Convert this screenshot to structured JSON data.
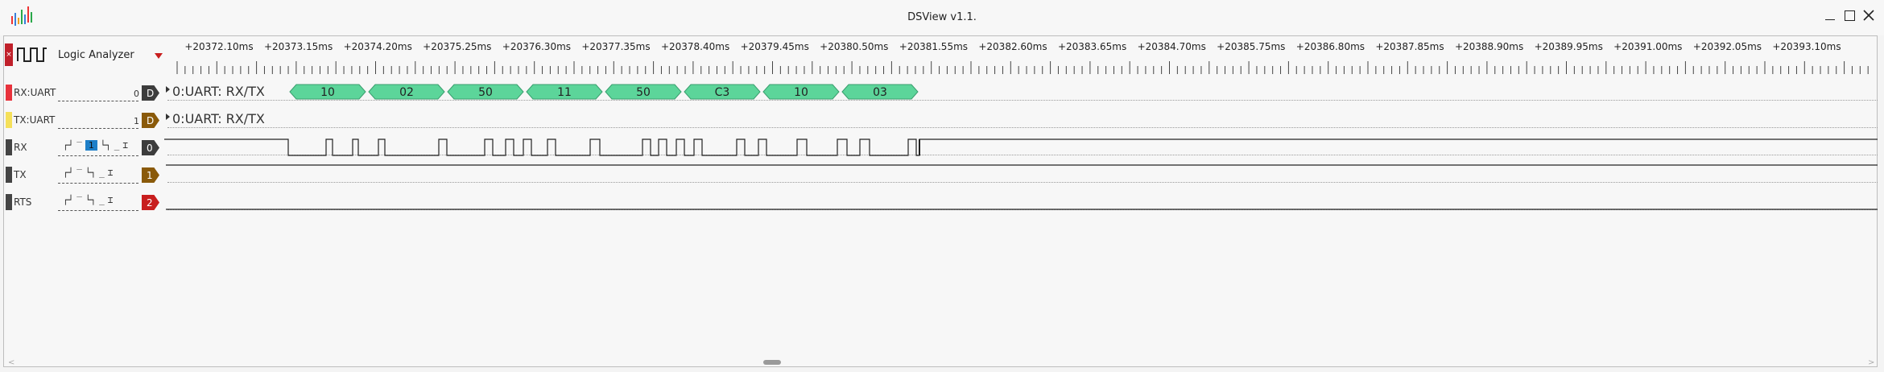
{
  "window": {
    "title": "DSView v1.1."
  },
  "device": {
    "label": "Logic Analyzer"
  },
  "ruler": {
    "ticks": [
      "+20372.10ms",
      "+20373.15ms",
      "+20374.20ms",
      "+20375.25ms",
      "+20376.30ms",
      "+20377.35ms",
      "+20378.40ms",
      "+20379.45ms",
      "+20380.50ms",
      "+20381.55ms",
      "+20382.60ms",
      "+20383.65ms",
      "+20384.70ms",
      "+20385.75ms",
      "+20386.80ms",
      "+20387.85ms",
      "+20388.90ms",
      "+20389.95ms",
      "+20391.00ms",
      "+20392.05ms",
      "+20393.10ms"
    ]
  },
  "channels": [
    {
      "name": "RX:UART",
      "index": "0",
      "tag": "D",
      "color": "#e8323c",
      "tag_color": "#3c3c3c",
      "decoder": "0:UART: RX/TX"
    },
    {
      "name": "TX:UART",
      "index": "1",
      "tag": "D",
      "color": "#f5e05a",
      "tag_color": "#8a5a0a",
      "decoder": "0:UART: RX/TX"
    },
    {
      "name": "RX",
      "tag": "0",
      "color": "#444444",
      "tag_color": "#3c3c3c"
    },
    {
      "name": "TX",
      "tag": "1",
      "color": "#444444",
      "tag_color": "#8a5a0a"
    },
    {
      "name": "RTS",
      "tag": "2",
      "color": "#444444",
      "tag_color": "#c81e1e"
    }
  ],
  "trigger_selected": "1",
  "decoded_bytes": [
    "10",
    "02",
    "50",
    "11",
    "50",
    "C3",
    "10",
    "03"
  ],
  "colors": {
    "decode_fill": "#5cd59a",
    "decode_stroke": "#3a9e6e",
    "accent_red": "#c81e1e"
  }
}
